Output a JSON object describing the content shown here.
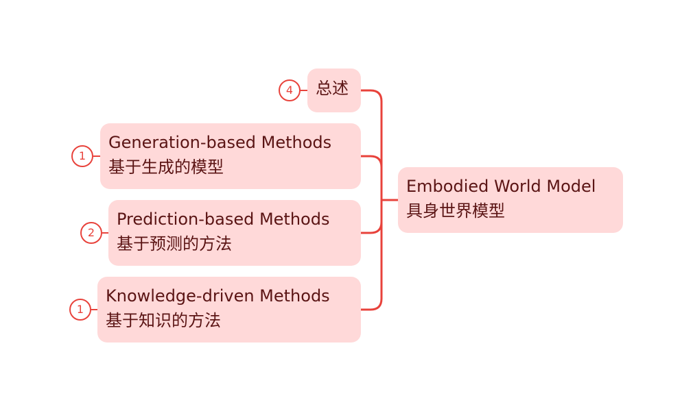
{
  "colors": {
    "connector": "#e8423b",
    "node_fill": "#ffd9d9",
    "node_text": "#5a1414",
    "badge_stroke": "#e8423b"
  },
  "root": {
    "line1": "Embodied World Model",
    "line2": "具身世界模型"
  },
  "branches": [
    {
      "line1": "总述",
      "badge": "4"
    },
    {
      "line1": "Generation-based Methods",
      "line2": "基于生成的模型",
      "badge": "1"
    },
    {
      "line1": "Prediction-based Methods",
      "line2": "基于预测的方法",
      "badge": "2"
    },
    {
      "line1": "Knowledge-driven Methods",
      "line2": "基于知识的方法",
      "badge": "1"
    }
  ]
}
